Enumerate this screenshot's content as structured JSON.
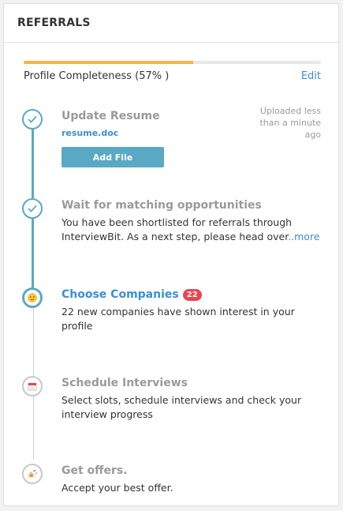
{
  "header": {
    "title": "REFERRALS"
  },
  "profile": {
    "label": "Profile Completeness (57% )",
    "progress_fraction": 0.57,
    "edit_label": "Edit",
    "progress_color": "#f2b54a"
  },
  "steps": [
    {
      "title": "Update Resume",
      "status": "done",
      "file": "resume.doc",
      "uploaded": "Uploaded less than a minute ago",
      "button": "Add File",
      "icon": "check-icon"
    },
    {
      "title": "Wait for matching opportunities",
      "status": "done",
      "desc": "You have been shortlisted for referrals through InterviewBit. As a next step, please head over",
      "more": "..more",
      "icon": "check-icon"
    },
    {
      "title": "Choose Companies",
      "status": "active",
      "badge": "22",
      "desc": "22 new companies have shown interest in your profile",
      "icon": "thinking-face-icon"
    },
    {
      "title": "Schedule Interviews",
      "status": "pending",
      "desc": "Select slots, schedule interviews and check your interview progress",
      "icon": "calendar-icon"
    },
    {
      "title": "Get offers.",
      "status": "pending",
      "desc": "Accept your best offer.",
      "icon": "party-popper-icon"
    }
  ],
  "colors": {
    "accent": "#5aa9c4",
    "link": "#3a8fd6",
    "badge": "#e8464d"
  }
}
